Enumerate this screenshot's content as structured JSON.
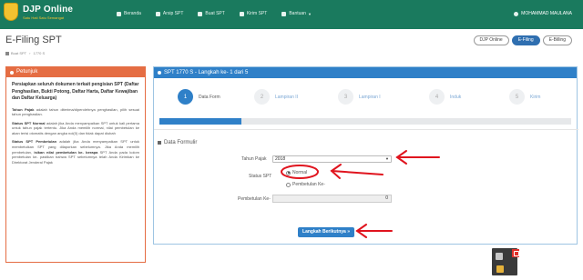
{
  "brand": {
    "title": "DJP Online",
    "subtitle": "Satu Hati Satu Semangat"
  },
  "nav": {
    "items": [
      {
        "label": "Beranda",
        "icon": "home-icon"
      },
      {
        "label": "Arsip SPT",
        "icon": "archive-icon"
      },
      {
        "label": "Buat SPT",
        "icon": "edit-icon"
      },
      {
        "label": "Kirim SPT",
        "icon": "send-icon"
      },
      {
        "label": "Bantuan",
        "icon": "help-icon",
        "dropdown": true
      }
    ],
    "user": "MOHAMMAD MAULANA"
  },
  "header": {
    "title": "E-Filing SPT",
    "breadcrumb": [
      "Buat SPT",
      "1770 S"
    ],
    "pills": [
      {
        "label": "DJP Online",
        "active": false
      },
      {
        "label": "E-Filing",
        "active": true
      },
      {
        "label": "E-Billing",
        "active": false
      }
    ]
  },
  "sidebar": {
    "heading": "Petunjuk",
    "lead": "Persiapkan seluruh dokumen terkait pengisian SPT (Daftar Penghasilan, Bukti Potong, Daftar Harta, Daftar Kewajiban dan Daftar Keluarga)",
    "p1_term": "Tahun Pajak",
    "p1_text": "adalah tahun diterima/diperolehnya penghasilan, pilih sesuai tahun penghasilan.",
    "p2_term": "Status SPT Normal",
    "p2_text": "adalah jika Anda menyampaikan SPT untuk kali pertama untuk tahun pajak tertentu. Jika Anda memilih normal, nilai pembetulan ke akan terisi otomatis dengan angka nol(0) dan tidak dapat diubah",
    "p3_term": "Status SPT Pembetulan",
    "p3_text": "adalah jika Anda menyampaikan SPT untuk membetulkan SPT yang dilaporkan sebelumnya. Jika Anda memilih pembetulan,",
    "p3_bold": "isikan nilai pembetulan ke- berapa",
    "p3_tail": "SPT Anda pada kolom pembetulan ke- pastikan bahwa SPT sebelumnya telah Anda Kirimkan ke Direktorat Jenderal Pajak"
  },
  "form": {
    "panel_title": "SPT 1770 S - Langkah ke- 1 dari 5",
    "steps": [
      {
        "num": "1",
        "label": "Data Form",
        "active": true
      },
      {
        "num": "2",
        "label": "Lampiran II",
        "active": false
      },
      {
        "num": "3",
        "label": "Lampiran I",
        "active": false
      },
      {
        "num": "4",
        "label": "Induk",
        "active": false
      },
      {
        "num": "5",
        "label": "Kirim",
        "active": false
      }
    ],
    "progress": 0.2,
    "section_title": "Data Formulir",
    "tahun_label": "Tahun Pajak",
    "tahun_value": "2018",
    "status_label": "Status SPT",
    "status_normal": "Normal",
    "status_pembetulan": "Pembetulan Ke-",
    "status_selected": "Normal",
    "pembetulan_label": "Pembetulan Ke-",
    "pembetulan_value": "0",
    "next_label": "Langkah Berikutnya"
  },
  "colors": {
    "navbar": "#1a7a5e",
    "brand_accent": "#f2c230",
    "sidebar_accent": "#e56d43",
    "primary": "#2f80c8",
    "annotation": "#e0141e"
  }
}
